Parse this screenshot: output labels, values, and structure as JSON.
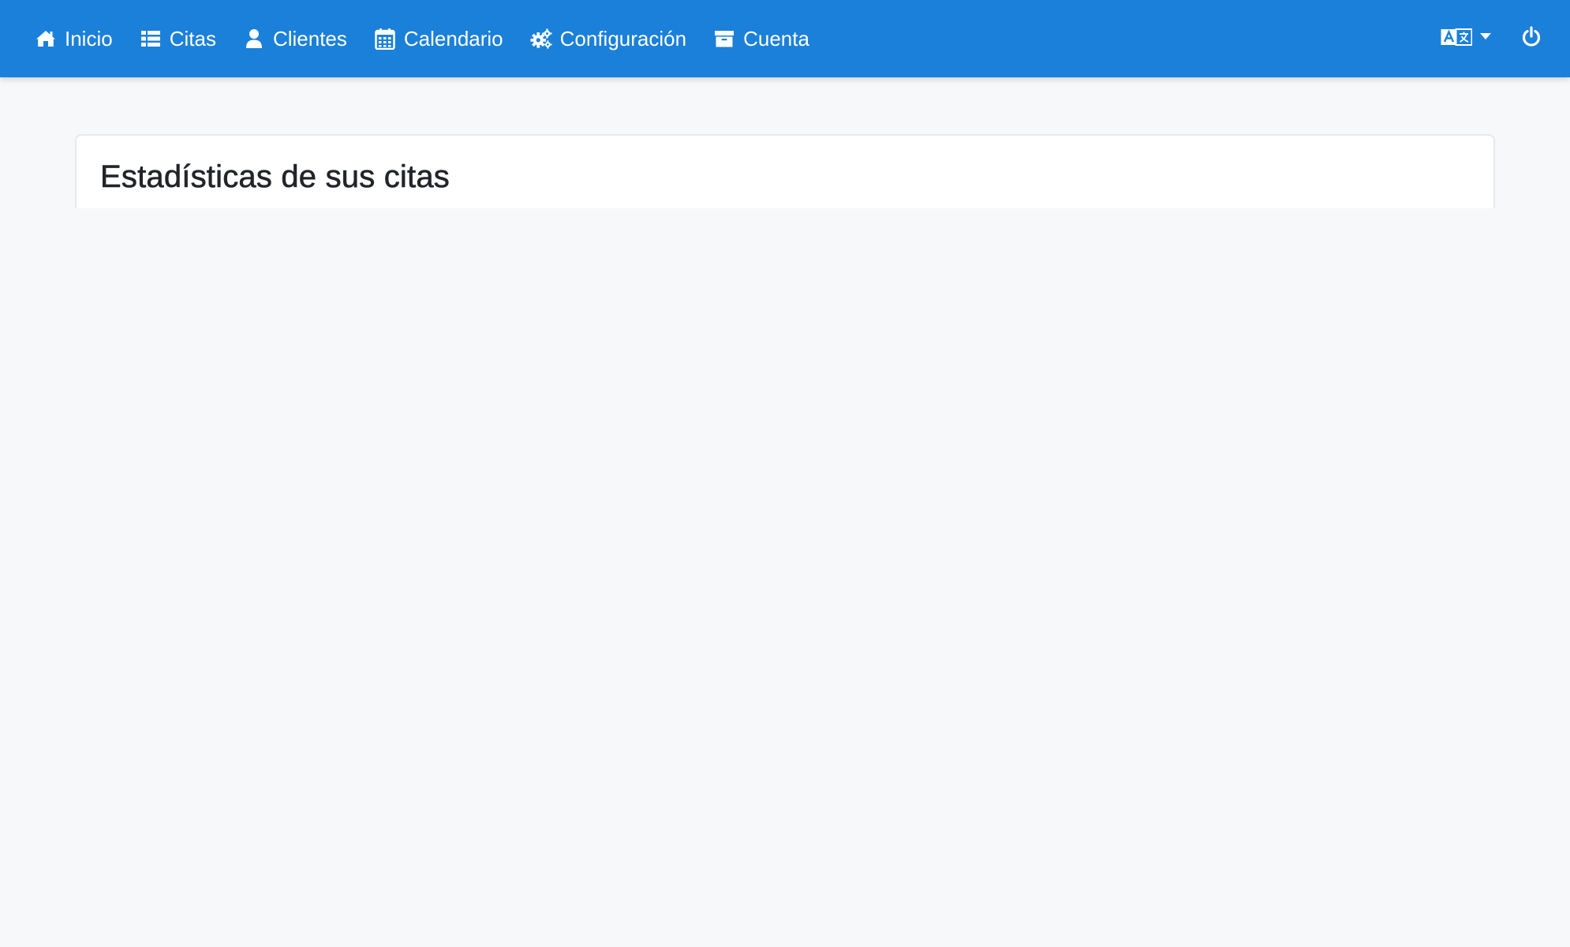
{
  "navbar": {
    "background_color": "#1b80d9",
    "items": [
      {
        "label": "Inicio",
        "icon": "home-icon"
      },
      {
        "label": "Citas",
        "icon": "list-icon"
      },
      {
        "label": "Clientes",
        "icon": "user-icon"
      },
      {
        "label": "Calendario",
        "icon": "calendar-icon"
      },
      {
        "label": "Configuración",
        "icon": "cogs-icon"
      },
      {
        "label": "Cuenta",
        "icon": "archive-icon"
      }
    ],
    "right": {
      "language_icon": "language-icon",
      "dropdown_icon": "caret-down-icon",
      "logout_icon": "power-icon"
    }
  },
  "main": {
    "card_title": "Estadísticas de sus citas"
  }
}
